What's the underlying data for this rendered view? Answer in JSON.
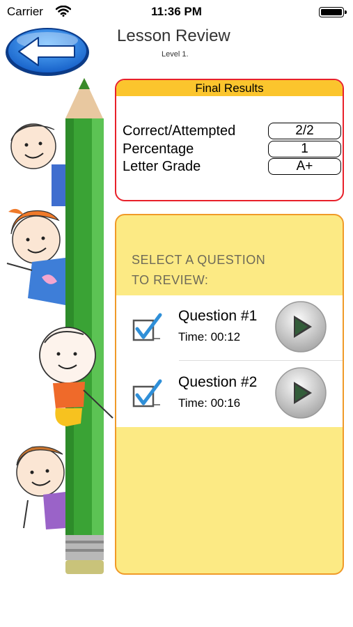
{
  "status_bar": {
    "carrier": "Carrier",
    "time": "11:36 PM"
  },
  "header": {
    "title": "Lesson Review",
    "subtitle": "Level 1.",
    "back_icon": "left-arrow-icon"
  },
  "results": {
    "heading": "Final Results",
    "rows": [
      {
        "label": "Correct/Attempted",
        "value": "2/2"
      },
      {
        "label": "Percentage",
        "value": "1"
      },
      {
        "label": "Letter Grade",
        "value": "A+"
      }
    ]
  },
  "review": {
    "prompt_line1": "SELECT A QUESTION",
    "prompt_line2": "TO REVIEW:",
    "questions": [
      {
        "title": "Question #1",
        "time": "Time: 00:12"
      },
      {
        "title": "Question #2",
        "time": "Time: 00:16"
      }
    ]
  },
  "colors": {
    "results_border": "#e8202a",
    "results_header": "#fbc52d",
    "panel_border": "#f09a28",
    "panel_fill": "#fcea84",
    "back_button": "#2e7fe0",
    "pencil": "#3aa335",
    "check": "#2f8fd8"
  }
}
